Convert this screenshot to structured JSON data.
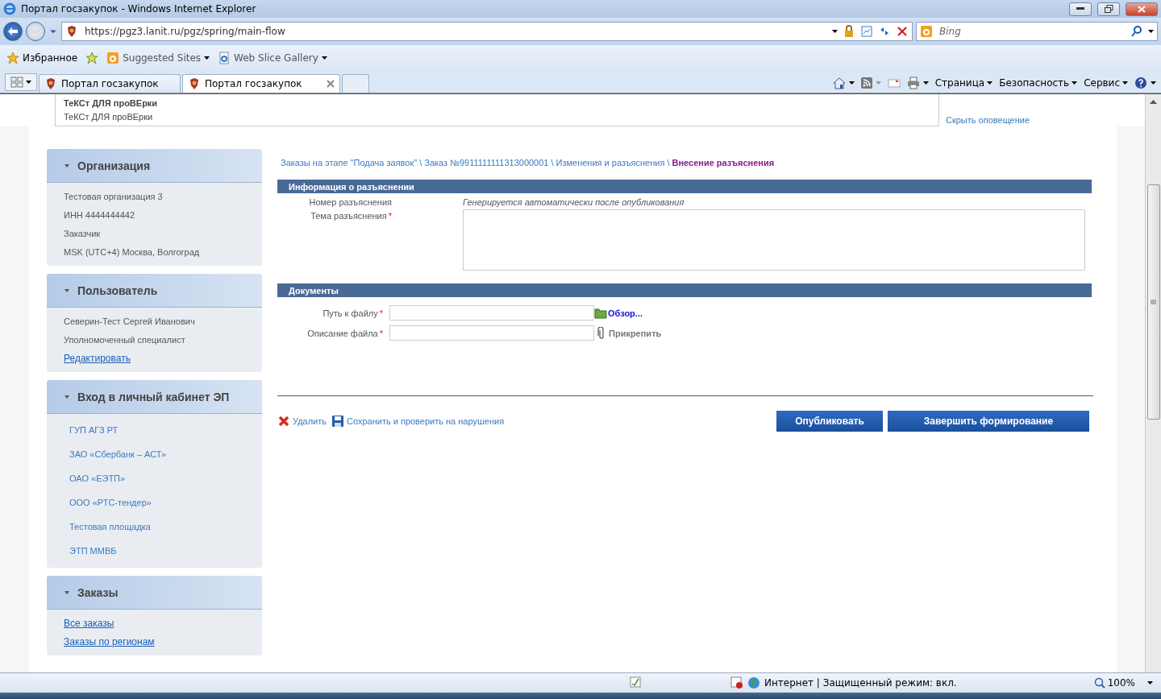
{
  "window": {
    "title": "Портал госзакупок - Windows Internet Explorer"
  },
  "address_bar": {
    "url": "https://pgz3.lanit.ru/pgz/spring/main-flow",
    "search_placeholder": "Bing"
  },
  "favorites_bar": {
    "label": "Избранное",
    "links": [
      "Suggested Sites",
      "Web Slice Gallery"
    ]
  },
  "tabs": [
    {
      "label": "Портал госзакупок",
      "selected": false
    },
    {
      "label": "Портал госзакупок",
      "selected": true
    }
  ],
  "command_bar": {
    "menus": [
      "Страница",
      "Безопасность",
      "Сервис"
    ]
  },
  "notice": {
    "title": "ТеКСт ДЛЯ проВЕрки",
    "text": "ТеКСт ДЛЯ проВЕрки",
    "hide_link": "Скрыть оповещение"
  },
  "sidebar": [
    {
      "title": "Организация",
      "items": [
        {
          "text": "Тестовая организация 3",
          "kind": "text"
        },
        {
          "text": "ИНН 4444444442",
          "kind": "text"
        },
        {
          "text": "Заказчик",
          "kind": "text"
        },
        {
          "text": "MSK (UTC+4) Москва, Волгоград",
          "kind": "text"
        }
      ]
    },
    {
      "title": "Пользователь",
      "items": [
        {
          "text": "Северин-Тест Сергей Иванович",
          "kind": "text"
        },
        {
          "text": "Уполномоченный специалист",
          "kind": "text"
        },
        {
          "text": "Редактировать",
          "kind": "underline-link"
        }
      ]
    },
    {
      "title": "Вход в личный кабинет ЭП",
      "items": [
        {
          "text": "ГУП АГЗ РТ",
          "kind": "link"
        },
        {
          "text": "ЗАО «Сбербанк – АСТ»",
          "kind": "link"
        },
        {
          "text": "ОАО «ЕЭТП»",
          "kind": "link"
        },
        {
          "text": "ООО «РТС-тендер»",
          "kind": "link"
        },
        {
          "text": "Тестовая площадка",
          "kind": "link"
        },
        {
          "text": "ЭТП ММВБ",
          "kind": "link"
        }
      ]
    },
    {
      "title": "Заказы",
      "items": [
        {
          "text": "Все заказы",
          "kind": "underline-link"
        },
        {
          "text": "Заказы по регионам",
          "kind": "underline-link"
        }
      ]
    }
  ],
  "breadcrumb": {
    "separator": "\\",
    "items": [
      {
        "text": "Заказы на этапе \"Подача заявок\"",
        "current": false
      },
      {
        "text": "Заказ №9911111111313000001",
        "current": false
      },
      {
        "text": "Изменения и разъяснения",
        "current": false
      },
      {
        "text": "Внесение разъяснения",
        "current": true
      }
    ]
  },
  "required_mark": "*",
  "info_section": {
    "title": "Информация о разъяснении",
    "number_label": "Номер разъяснения",
    "number_value": "Генерируется автоматически после опубликования",
    "topic_label": "Тема разъяснения",
    "topic_required": true
  },
  "documents_section": {
    "title": "Документы",
    "path_label": "Путь к файлу",
    "path_required": true,
    "browse_link": "Обзор...",
    "description_label": "Описание файла",
    "description_required": true,
    "attach_link": "Прикрепить"
  },
  "actions": {
    "delete": "Удалить",
    "save_check": "Сохранить и проверить на нарушения",
    "publish": "Опубликовать",
    "finish": "Завершить формирование"
  },
  "status_bar": {
    "zone": "Интернет | Защищенный режим: вкл.",
    "zoom": "100%"
  }
}
